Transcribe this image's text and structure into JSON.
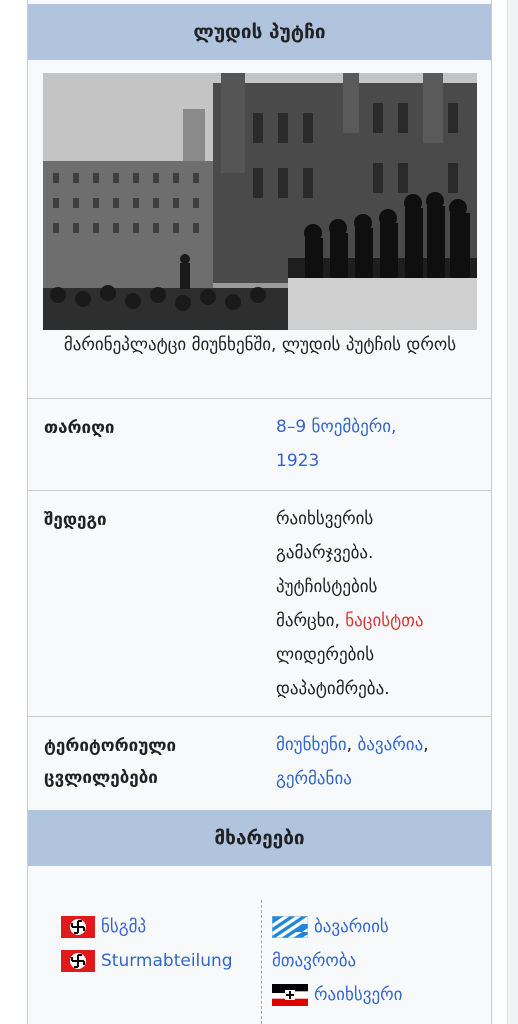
{
  "infobox": {
    "title": "ლუდის პუტჩი",
    "image_caption": "მარინეპლატცი მიუნხენში, ლუდის პუტჩის დროს",
    "rows": [
      {
        "label": "თარიღი",
        "value_line1": "8–9 ნოემბერი,",
        "value_line2": "1923"
      },
      {
        "label": "შედეგი",
        "lines": [
          "რაიხსვერის",
          "გამარჯვება.",
          "პუტჩისტების",
          "მარცხი,",
          "ნაცისტთა",
          "ლიდერების",
          "დაპატიმრება."
        ]
      },
      {
        "label_line1": "ტერიტორიული",
        "label_line2": "ცვლილებები",
        "links": [
          "მიუნხენი",
          "ბავარია",
          "გერმანია"
        ]
      }
    ],
    "parties_header": "მხარეები",
    "left_parties": [
      "ნსგმპ",
      "Sturmabteilung"
    ],
    "right_parties": [
      "ბავარიის",
      "მთავრობა",
      "რაიხსვერი"
    ],
    "colors": {
      "header": "#b0c4de",
      "link": "#3366cc",
      "red_link": "#d33636",
      "box_bg": "#f8f9fa"
    }
  }
}
